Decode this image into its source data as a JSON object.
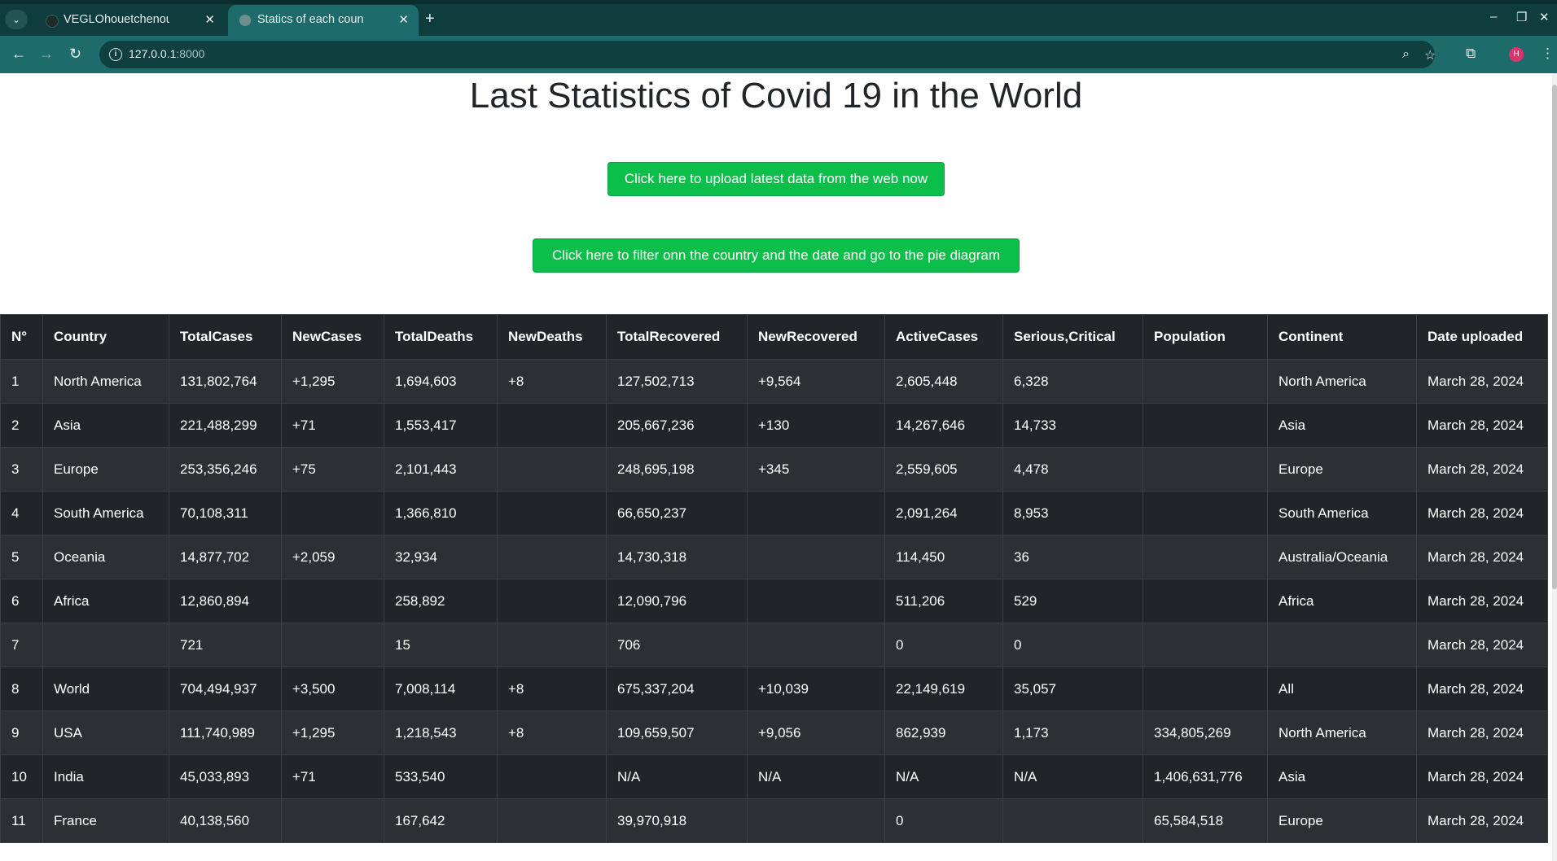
{
  "browser": {
    "tabs": [
      {
        "title": "VEGLOhouetchenouGAB",
        "active": false
      },
      {
        "title": "Statics of each country of",
        "active": true
      }
    ],
    "url": "127.0.0.1",
    "url_port": ":8000",
    "profile_initial": "H",
    "accent_color": "#1e6b6b"
  },
  "page": {
    "title": "Last Statistics of Covid 19 in the World",
    "upload_button": "Click here to upload latest data from the web now",
    "filter_button": "Click here to filter onn the country and the date and go to the pie diagram",
    "button_color": "#0bbf4a"
  },
  "table": {
    "headers": [
      "N°",
      "Country",
      "TotalCases",
      "NewCases",
      "TotalDeaths",
      "NewDeaths",
      "TotalRecovered",
      "NewRecovered",
      "ActiveCases",
      "Serious,Critical",
      "Population",
      "Continent",
      "Date uploaded"
    ],
    "rows": [
      [
        "1",
        "North America",
        "131,802,764",
        "+1,295",
        "1,694,603",
        "+8",
        "127,502,713",
        "+9,564",
        "2,605,448",
        "6,328",
        "",
        "North America",
        "March 28, 2024"
      ],
      [
        "2",
        "Asia",
        "221,488,299",
        "+71",
        "1,553,417",
        "",
        "205,667,236",
        "+130",
        "14,267,646",
        "14,733",
        "",
        "Asia",
        "March 28, 2024"
      ],
      [
        "3",
        "Europe",
        "253,356,246",
        "+75",
        "2,101,443",
        "",
        "248,695,198",
        "+345",
        "2,559,605",
        "4,478",
        "",
        "Europe",
        "March 28, 2024"
      ],
      [
        "4",
        "South America",
        "70,108,311",
        "",
        "1,366,810",
        "",
        "66,650,237",
        "",
        "2,091,264",
        "8,953",
        "",
        "South America",
        "March 28, 2024"
      ],
      [
        "5",
        "Oceania",
        "14,877,702",
        "+2,059",
        "32,934",
        "",
        "14,730,318",
        "",
        "114,450",
        "36",
        "",
        "Australia/Oceania",
        "March 28, 2024"
      ],
      [
        "6",
        "Africa",
        "12,860,894",
        "",
        "258,892",
        "",
        "12,090,796",
        "",
        "511,206",
        "529",
        "",
        "Africa",
        "March 28, 2024"
      ],
      [
        "7",
        "",
        "721",
        "",
        "15",
        "",
        "706",
        "",
        "0",
        "0",
        "",
        "",
        "March 28, 2024"
      ],
      [
        "8",
        "World",
        "704,494,937",
        "+3,500",
        "7,008,114",
        "+8",
        "675,337,204",
        "+10,039",
        "22,149,619",
        "35,057",
        "",
        "All",
        "March 28, 2024"
      ],
      [
        "9",
        "USA",
        "111,740,989",
        "+1,295",
        "1,218,543",
        "+8",
        "109,659,507",
        "+9,056",
        "862,939",
        "1,173",
        "334,805,269",
        "North America",
        "March 28, 2024"
      ],
      [
        "10",
        "India",
        "45,033,893",
        "+71",
        "533,540",
        "",
        "N/A",
        "N/A",
        "N/A",
        "N/A",
        "1,406,631,776",
        "Asia",
        "March 28, 2024"
      ],
      [
        "11",
        "France",
        "40,138,560",
        "",
        "167,642",
        "",
        "39,970,918",
        "",
        "0",
        "",
        "65,584,518",
        "Europe",
        "March 28, 2024"
      ]
    ]
  }
}
